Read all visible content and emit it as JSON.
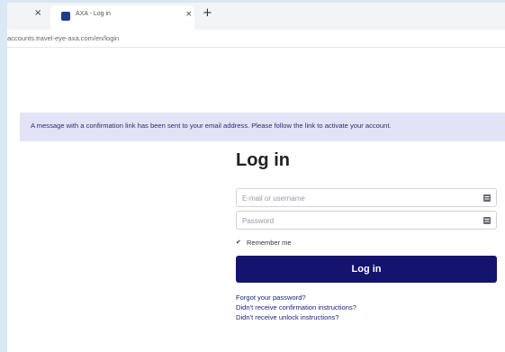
{
  "browser": {
    "tab": {
      "title": "AXA - Log in",
      "close_symbol": "×"
    },
    "prev_tab_close_symbol": "×",
    "new_tab_symbol": "+",
    "url": "accounts.travel-eye-axa.com/en/login"
  },
  "banner": {
    "message": "A message with a confirmation link has been sent to your email address. Please follow the link to activate your account."
  },
  "login": {
    "title": "Log in",
    "email_placeholder": "E-mail or username",
    "password_placeholder": "Password",
    "remember_label": "Remember me",
    "submit_label": "Log in"
  },
  "links": {
    "forgot": "Forgot your password?",
    "confirmation": "Didn't receive confirmation instructions?",
    "unlock": "Didn't receive unlock instructions?"
  },
  "colors": {
    "primary_button": "#14146e",
    "banner_bg": "#e3e3f7",
    "link": "#1a237e"
  },
  "icons": {
    "field_icon": "keyboard-icon",
    "favicon": "axa-favicon"
  }
}
